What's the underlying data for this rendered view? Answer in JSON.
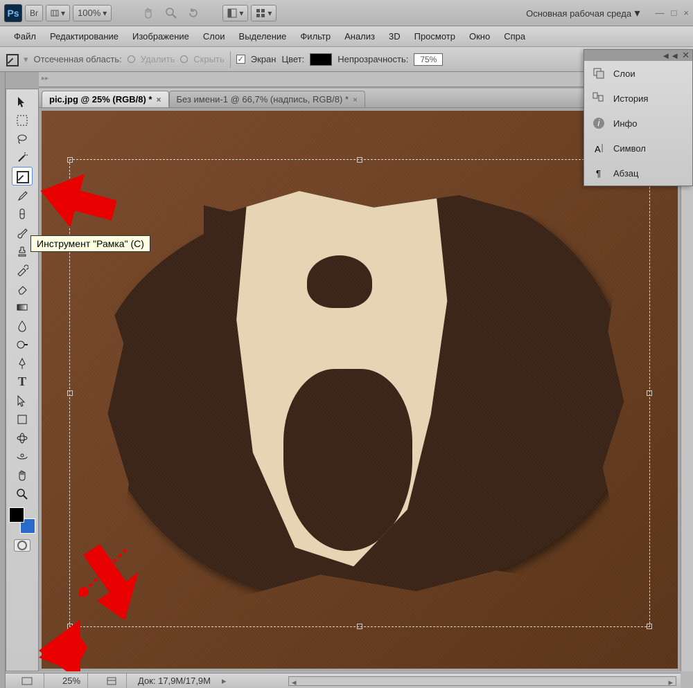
{
  "titlebar": {
    "workspace": "Основная рабочая среда",
    "zoom_val": "100%"
  },
  "menubar": [
    "Файл",
    "Редактирование",
    "Изображение",
    "Слои",
    "Выделение",
    "Фильтр",
    "Анализ",
    "3D",
    "Просмотр",
    "Окно",
    "Спра"
  ],
  "options": {
    "crop_area_label": "Отсеченная область:",
    "delete": "Удалить",
    "hide": "Скрыть",
    "screen": "Экран",
    "color": "Цвет:",
    "opacity": "Непрозрачность:",
    "opacity_val": "75%"
  },
  "tabs": [
    {
      "label": "pic.jpg @ 25% (RGB/8) *",
      "active": true
    },
    {
      "label": "Без имени-1 @ 66,7% (надпись, RGB/8) *",
      "active": false
    }
  ],
  "tooltip": "Инструмент \"Рамка\" (C)",
  "panels": [
    "Слои",
    "История",
    "Инфо",
    "Символ",
    "Абзац"
  ],
  "status": {
    "zoom": "25%",
    "doc": "Док: 17,9M/17,9M"
  }
}
